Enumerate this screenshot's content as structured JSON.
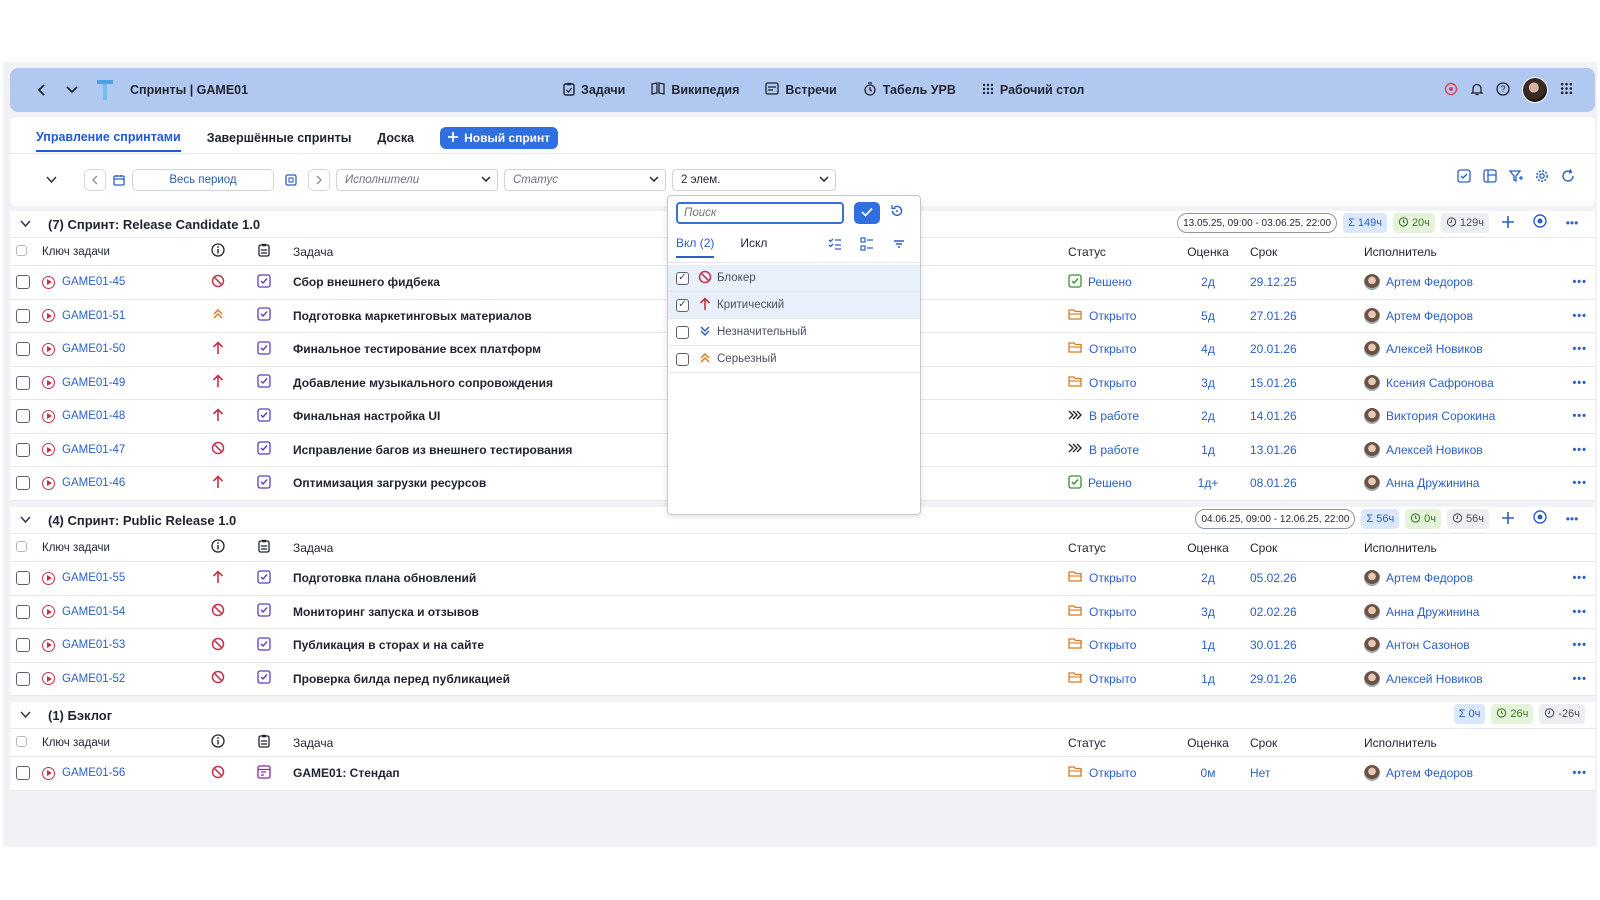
{
  "header": {
    "title": "Спринты | GAME01",
    "nav": [
      {
        "label": "Задачи",
        "icon": "clipboard-icon"
      },
      {
        "label": "Википедия",
        "icon": "book-icon"
      },
      {
        "label": "Встречи",
        "icon": "meeting-icon"
      },
      {
        "label": "Табель УРВ",
        "icon": "timesheet-icon"
      },
      {
        "label": "Рабочий стол",
        "icon": "grid-icon"
      }
    ]
  },
  "tabs": {
    "manage": "Управление спринтами",
    "completed": "Завершённые спринты",
    "board": "Доска",
    "new_sprint": "Новый спринт"
  },
  "filters": {
    "period": "Весь период",
    "assignees_placeholder": "Исполнители",
    "status_placeholder": "Статус",
    "priority_value": "2 элем."
  },
  "columns": {
    "key": "Ключ задачи",
    "task": "Задача",
    "status": "Статус",
    "estimate": "Оценка",
    "due": "Срок",
    "assignee": "Исполнитель"
  },
  "sprints": [
    {
      "title": "(7) Спринт: Release Candidate 1.0",
      "dates": "13.05.25, 09:00 - 03.06.25, 22:00",
      "total": "149ч",
      "spent": "20ч",
      "remaining": "129ч",
      "rows": [
        {
          "key": "GAME01-45",
          "prio": "blocker",
          "task": "Сбор внешнего фидбека",
          "status": "Решено",
          "status_icon": "resolved",
          "est": "2д",
          "due": "29.12.25",
          "user": "Артем Федоров"
        },
        {
          "key": "GAME01-51",
          "prio": "serious",
          "task": "Подготовка маркетинговых материалов",
          "status": "Открыто",
          "status_icon": "open",
          "est": "5д",
          "due": "27.01.26",
          "user": "Артем Федоров"
        },
        {
          "key": "GAME01-50",
          "prio": "critical",
          "task": "Финальное тестирование всех платформ",
          "status": "Открыто",
          "status_icon": "open",
          "est": "4д",
          "due": "20.01.26",
          "user": "Алексей Новиков"
        },
        {
          "key": "GAME01-49",
          "prio": "critical",
          "task": "Добавление музыкального сопровождения",
          "status": "Открыто",
          "status_icon": "open",
          "est": "3д",
          "due": "15.01.26",
          "user": "Ксения Сафронова"
        },
        {
          "key": "GAME01-48",
          "prio": "critical",
          "task": "Финальная настройка UI",
          "status": "В работе",
          "status_icon": "progress",
          "est": "2д",
          "due": "14.01.26",
          "user": "Виктория Сорокина"
        },
        {
          "key": "GAME01-47",
          "prio": "blocker",
          "task": "Исправление багов из внешнего тестирования",
          "status": "В работе",
          "status_icon": "progress",
          "est": "1д",
          "due": "13.01.26",
          "user": "Алексей Новиков"
        },
        {
          "key": "GAME01-46",
          "prio": "critical",
          "task": "Оптимизация загрузки ресурсов",
          "status": "Решено",
          "status_icon": "resolved",
          "est": "1д+",
          "due": "08.01.26",
          "user": "Анна Дружинина"
        }
      ]
    },
    {
      "title": "(4) Спринт: Public Release 1.0",
      "dates": "04.06.25, 09:00 - 12.06.25, 22:00",
      "total": "56ч",
      "spent": "0ч",
      "remaining": "56ч",
      "rows": [
        {
          "key": "GAME01-55",
          "prio": "critical",
          "task": "Подготовка плана обновлений",
          "status": "Открыто",
          "status_icon": "open",
          "est": "2д",
          "due": "05.02.26",
          "user": "Артем Федоров"
        },
        {
          "key": "GAME01-54",
          "prio": "blocker",
          "task": "Мониторинг запуска и отзывов",
          "status": "Открыто",
          "status_icon": "open",
          "est": "3д",
          "due": "02.02.26",
          "user": "Анна Дружинина"
        },
        {
          "key": "GAME01-53",
          "prio": "blocker",
          "task": "Публикация в сторах и на сайте",
          "status": "Открыто",
          "status_icon": "open",
          "est": "1д",
          "due": "30.01.26",
          "user": "Антон Сазонов"
        },
        {
          "key": "GAME01-52",
          "prio": "blocker",
          "task": "Проверка билда перед публикацией",
          "status": "Открыто",
          "status_icon": "open",
          "est": "1д",
          "due": "29.01.26",
          "user": "Алексей Новиков"
        }
      ]
    },
    {
      "title": "(1) Бэклог",
      "dates": "",
      "total": "0ч",
      "spent": "26ч",
      "remaining": "-26ч",
      "rows": [
        {
          "key": "GAME01-56",
          "prio": "blocker",
          "task": "GAME01: Стендап",
          "status": "Открыто",
          "status_icon": "open",
          "est": "0м",
          "due": "Нет",
          "user": "Артем Федоров",
          "type": "meeting"
        }
      ]
    }
  ],
  "dropdown": {
    "search_placeholder": "Поиск",
    "tab_include": "Вкл (2)",
    "tab_exclude": "Искл",
    "items": [
      {
        "label": "Блокер",
        "checked": true,
        "prio": "blocker"
      },
      {
        "label": "Критический",
        "checked": true,
        "prio": "critical"
      },
      {
        "label": "Незначительный",
        "checked": false,
        "prio": "minor"
      },
      {
        "label": "Серьезный",
        "checked": false,
        "prio": "serious"
      }
    ]
  },
  "colors": {
    "accent": "#2f6fe0",
    "link": "#2c5fc4",
    "topbar": "#b1c8f0",
    "blocker": "#c2334a",
    "open": "#d97a1e",
    "resolved": "#3c8a3a"
  }
}
